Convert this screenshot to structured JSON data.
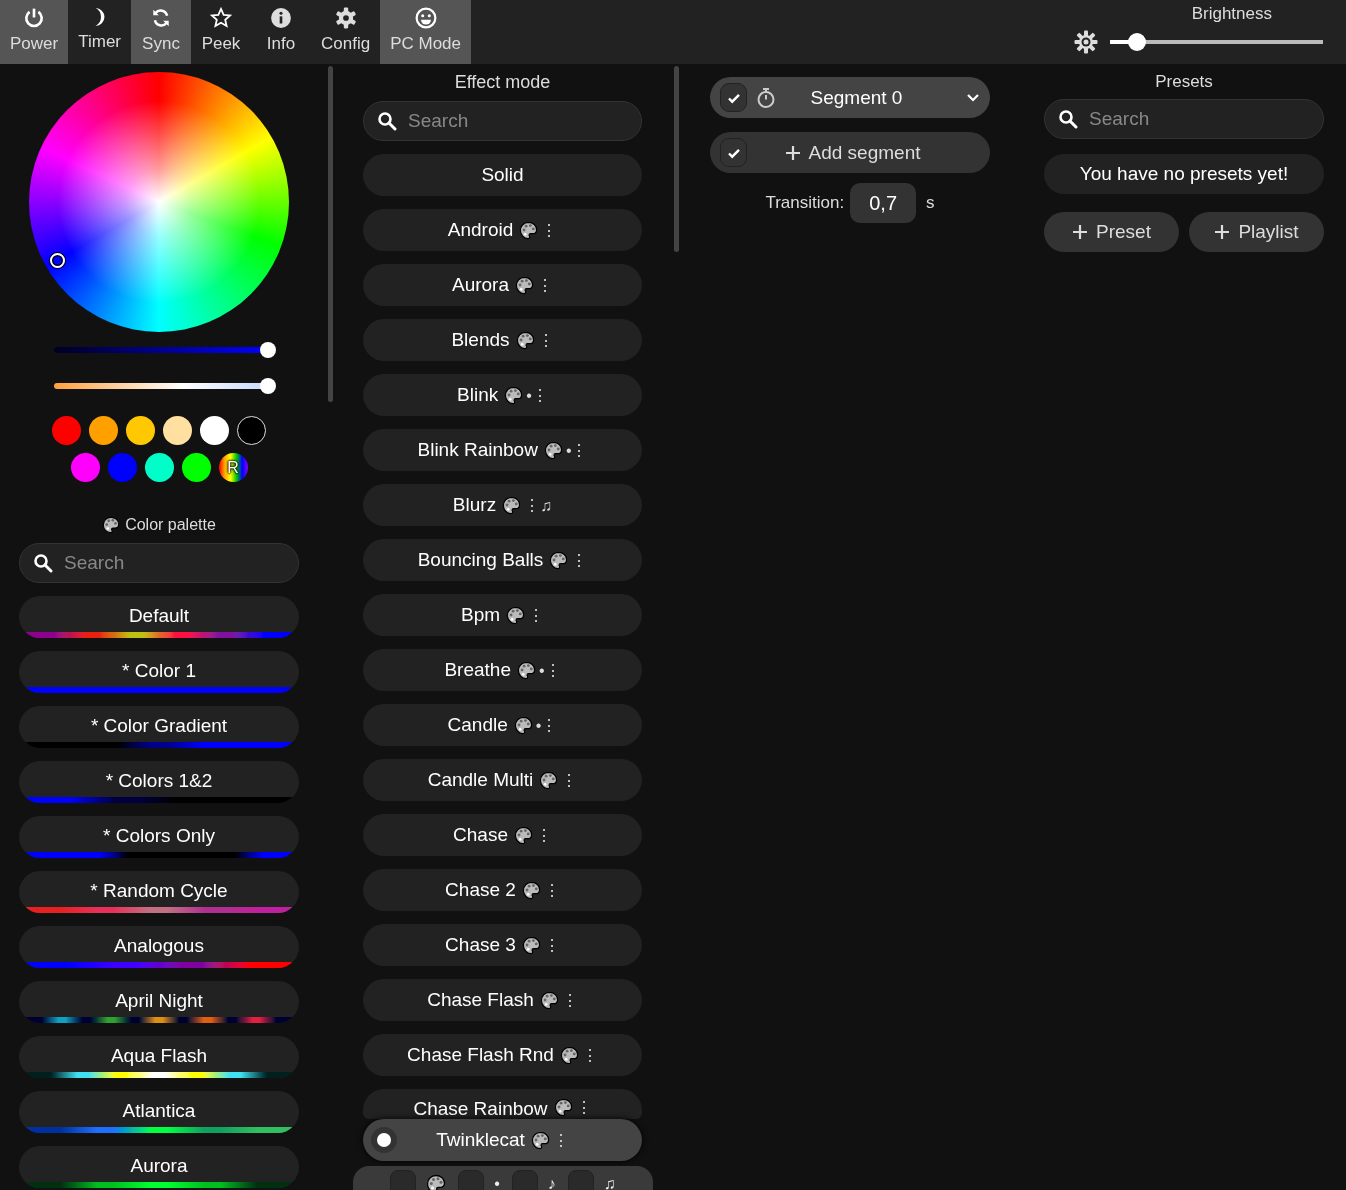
{
  "top_bar": {
    "tabs": [
      {
        "label": "Power",
        "on": true
      },
      {
        "label": "Timer",
        "on": false
      },
      {
        "label": "Sync",
        "on": true
      },
      {
        "label": "Peek",
        "on": false
      },
      {
        "label": "Info",
        "on": false
      },
      {
        "label": "Config",
        "on": false
      },
      {
        "label": "PC Mode",
        "on": true
      }
    ],
    "brightness": {
      "label": "Brightness",
      "level": 0.09
    }
  },
  "color": {
    "sliders": [
      {
        "kind": "value",
        "level": 1
      },
      {
        "kind": "white_balance",
        "level": 1
      }
    ],
    "swatches": [
      {
        "kind": "solid",
        "color": "#ff0000"
      },
      {
        "kind": "solid",
        "color": "#ffa000"
      },
      {
        "kind": "solid",
        "color": "#ffc800"
      },
      {
        "kind": "solid",
        "color": "#ffe0a0"
      },
      {
        "kind": "solid",
        "color": "#ffffff"
      },
      {
        "kind": "solid",
        "color": "#000000"
      },
      {
        "kind": "solid",
        "color": "#ff00ff"
      },
      {
        "kind": "solid",
        "color": "#0000ff"
      },
      {
        "kind": "solid",
        "color": "#00ffc8"
      },
      {
        "kind": "solid",
        "color": "#00ff00"
      },
      {
        "kind": "random",
        "label": "R"
      }
    ]
  },
  "palette": {
    "title": "Color palette",
    "search": {
      "placeholder": "Search"
    },
    "items": [
      {
        "name": "Default",
        "selected": false,
        "stops": [
          {
            "color": "#900090"
          },
          {
            "color": "#e82010"
          },
          {
            "color": "#c0c010"
          },
          {
            "color": "#ff1040"
          },
          {
            "color": "#8010a0"
          },
          {
            "color": "#0000ff"
          }
        ]
      },
      {
        "name": "* Color 1",
        "selected": false,
        "stops": [
          {
            "color": "#0000ff"
          },
          {
            "color": "#0000ff"
          }
        ]
      },
      {
        "name": "* Color Gradient",
        "selected": false,
        "stops": [
          {
            "color": "#000000"
          },
          {
            "color": "#000000"
          },
          {
            "color": "#00008a"
          },
          {
            "color": "#0000ff"
          },
          {
            "color": "#0000ff"
          }
        ]
      },
      {
        "name": "* Colors 1&2",
        "selected": false,
        "stops": [
          {
            "color": "#0000ff"
          },
          {
            "color": "#000040"
          },
          {
            "color": "#000000"
          },
          {
            "color": "#000000"
          }
        ]
      },
      {
        "name": "* Colors Only",
        "selected": false,
        "stops": [
          {
            "color": "#0000ff"
          },
          {
            "color": "#0000ff"
          },
          {
            "color": "#000000"
          },
          {
            "color": "#000000"
          },
          {
            "color": "#000000"
          },
          {
            "color": "#0000ff"
          }
        ]
      },
      {
        "name": "* Random Cycle",
        "selected": false,
        "stops": [
          {
            "color": "#e82020"
          },
          {
            "color": "#e8305a"
          },
          {
            "color": "#c07080"
          },
          {
            "color": "#b03090"
          },
          {
            "color": "#c020a0"
          }
        ]
      },
      {
        "name": "Analogous",
        "selected": false,
        "stops": [
          {
            "color": "#0000ff"
          },
          {
            "color": "#4000ff"
          },
          {
            "color": "#8000a0"
          },
          {
            "color": "#ff0000"
          }
        ]
      },
      {
        "name": "April Night",
        "selected": false,
        "stops": [
          {
            "color": "#000030"
          },
          {
            "color": "#10a0c0"
          },
          {
            "color": "#000030"
          },
          {
            "color": "#30a030"
          },
          {
            "color": "#000030"
          },
          {
            "color": "#e09010"
          },
          {
            "color": "#000030"
          },
          {
            "color": "#e06010"
          },
          {
            "color": "#000030"
          },
          {
            "color": "#e02040"
          },
          {
            "color": "#000030"
          }
        ]
      },
      {
        "name": "Aqua Flash",
        "selected": false,
        "stops": [
          {
            "color": "#002020"
          },
          {
            "color": "#40e0f0"
          },
          {
            "color": "#ffff00"
          },
          {
            "color": "#ffffff"
          },
          {
            "color": "#ffff00"
          },
          {
            "color": "#40e0f0"
          },
          {
            "color": "#002020"
          }
        ]
      },
      {
        "name": "Atlantica",
        "selected": false,
        "stops": [
          {
            "color": "#0030a0"
          },
          {
            "color": "#2070ff"
          },
          {
            "color": "#00ff40"
          },
          {
            "color": "#10a060"
          },
          {
            "color": "#30c060"
          }
        ]
      },
      {
        "name": "Aurora",
        "selected": false,
        "stops": [
          {
            "color": "#003010"
          },
          {
            "color": "#00c020"
          },
          {
            "color": "#00ff30"
          },
          {
            "color": "#00c020"
          },
          {
            "color": "#003010"
          }
        ]
      }
    ]
  },
  "effects": {
    "title": "Effect mode",
    "search": {
      "placeholder": "Search"
    },
    "items": [
      {
        "name": "Solid",
        "palette": false,
        "selected": false
      },
      {
        "name": "Android",
        "palette": true,
        "flags": "⋮",
        "selected": false
      },
      {
        "name": "Aurora",
        "palette": true,
        "flags": "⋮",
        "selected": false
      },
      {
        "name": "Blends",
        "palette": true,
        "flags": "⋮",
        "selected": false
      },
      {
        "name": "Blink",
        "palette": true,
        "flags": "•⋮",
        "selected": false
      },
      {
        "name": "Blink Rainbow",
        "palette": true,
        "flags": "•⋮",
        "selected": false
      },
      {
        "name": "Blurz",
        "palette": true,
        "flags": "⋮♫",
        "selected": false
      },
      {
        "name": "Bouncing Balls",
        "palette": true,
        "flags": "⋮",
        "selected": false
      },
      {
        "name": "Bpm",
        "palette": true,
        "flags": "⋮",
        "selected": false
      },
      {
        "name": "Breathe",
        "palette": true,
        "flags": "•⋮",
        "selected": false
      },
      {
        "name": "Candle",
        "palette": true,
        "flags": "•⋮",
        "selected": false
      },
      {
        "name": "Candle Multi",
        "palette": true,
        "flags": "⋮",
        "selected": false
      },
      {
        "name": "Chase",
        "palette": true,
        "flags": "⋮",
        "selected": false
      },
      {
        "name": "Chase 2",
        "palette": true,
        "flags": "⋮",
        "selected": false
      },
      {
        "name": "Chase 3",
        "palette": true,
        "flags": "⋮",
        "selected": false
      },
      {
        "name": "Chase Flash",
        "palette": true,
        "flags": "⋮",
        "selected": false
      },
      {
        "name": "Chase Flash Rnd",
        "palette": true,
        "flags": "⋮",
        "selected": false
      },
      {
        "name": "Chase Rainbow",
        "palette": true,
        "flags": "⋮",
        "selected": false
      }
    ],
    "current": {
      "name": "Twinklecat",
      "palette": true,
      "flags": "⋮",
      "checked": true
    },
    "filters": [
      {
        "kind": "palette",
        "on": false
      },
      {
        "kind": "mark",
        "label": "•",
        "on": false
      },
      {
        "kind": "mark",
        "label": "♪",
        "on": false
      },
      {
        "kind": "mark",
        "label": "♫",
        "on": false
      }
    ]
  },
  "segments": {
    "items": [
      {
        "name": "Segment 0",
        "checked": true,
        "expanded": false
      }
    ],
    "add": {
      "label": "Add segment",
      "checked": true
    },
    "transition": {
      "label": "Transition:",
      "value": "0,7",
      "unit": "s"
    }
  },
  "presets": {
    "title": "Presets",
    "search": {
      "placeholder": "Search"
    },
    "message": "You have no presets yet!",
    "buttons": [
      {
        "label": "Preset"
      },
      {
        "label": "Playlist"
      }
    ]
  }
}
